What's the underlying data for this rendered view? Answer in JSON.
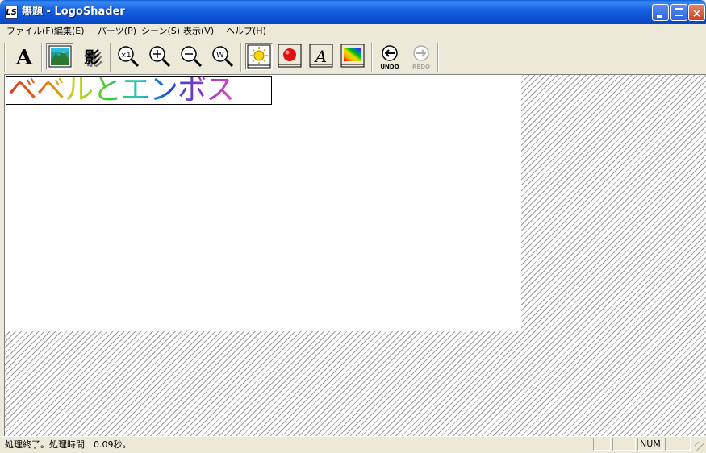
{
  "window": {
    "title": "無題 - LogoShader",
    "app_icon_text": "LS",
    "controls": {
      "minimize": "minimize-icon",
      "maximize": "maximize-icon",
      "close": "×"
    }
  },
  "menu": [
    {
      "label": "ファイル(F)"
    },
    {
      "label": "編集(E)"
    },
    {
      "label": "パーツ(P)"
    },
    {
      "label": "シーン(S)"
    },
    {
      "label": "表示(V)"
    },
    {
      "label": "ヘルプ(H)"
    }
  ],
  "toolbar": {
    "text_tool_glyph": "A",
    "shadow_tool_glyph": "影",
    "zoom_actual_glyph": "×1",
    "zoom_window_glyph": "W",
    "italic_glyph": "A",
    "undo_label": "UNDO",
    "redo_label": "REDO"
  },
  "canvas": {
    "logo_text": "ベベルとエンボス"
  },
  "status": {
    "message": "処理終了。処理時間　0.09秒。",
    "num": "NUM"
  }
}
